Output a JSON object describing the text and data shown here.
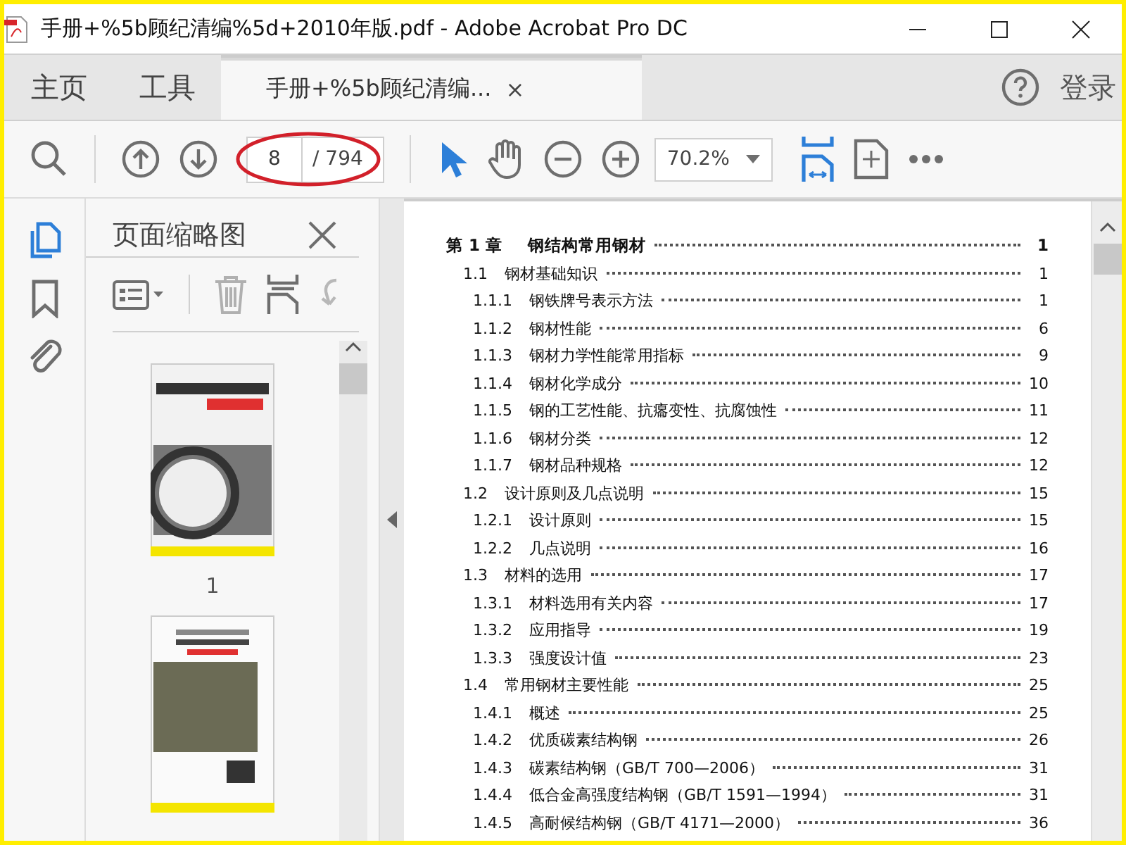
{
  "window": {
    "title": "手册+%5b顾纪清编%5d+2010年版.pdf - Adobe Acrobat Pro DC"
  },
  "tabs": [
    {
      "label": "主页",
      "kind": "home",
      "selected": false
    },
    {
      "label": "工具",
      "kind": "tools",
      "selected": false
    },
    {
      "label": "手册+%5b顾纪清编...",
      "kind": "document",
      "selected": true,
      "close": "×"
    }
  ],
  "account": {
    "label": "登录"
  },
  "toolbar": {
    "page_field": {
      "value": "8"
    },
    "page_total": "/ 794",
    "zoom": {
      "value": "70.2%"
    }
  },
  "side_rail": [
    {
      "kind": "pages",
      "selected": true
    },
    {
      "kind": "bookmarks",
      "selected": false
    },
    {
      "kind": "attachments",
      "selected": false
    }
  ],
  "thumbnail_panel": {
    "title": "页面缩略图",
    "thumbnails": [
      {
        "kind": "front-cover",
        "label": "1"
      },
      {
        "kind": "back-cover"
      }
    ]
  },
  "toc": [
    {
      "number": "第 1 章",
      "title": "钢结构常用钢材",
      "page": "1",
      "children": [
        {
          "number": "1.1",
          "title": "钢材基础知识",
          "page": "1",
          "children": [
            {
              "number": "1.1.1",
              "title": "钢铁牌号表示方法",
              "page": "1"
            },
            {
              "number": "1.1.2",
              "title": "钢材性能",
              "page": "6"
            },
            {
              "number": "1.1.3",
              "title": "钢材力学性能常用指标",
              "page": "9"
            },
            {
              "number": "1.1.4",
              "title": "钢材化学成分",
              "page": "10"
            },
            {
              "number": "1.1.5",
              "title": "钢的工艺性能、抗癟变性、抗腐蚀性",
              "page": "11"
            },
            {
              "number": "1.1.6",
              "title": "钢材分类",
              "page": "12"
            },
            {
              "number": "1.1.7",
              "title": "钢材品种规格",
              "page": "12"
            }
          ]
        },
        {
          "number": "1.2",
          "title": "设计原则及几点说明",
          "page": "15",
          "children": [
            {
              "number": "1.2.1",
              "title": "设计原则",
              "page": "15"
            },
            {
              "number": "1.2.2",
              "title": "几点说明",
              "page": "16"
            }
          ]
        },
        {
          "number": "1.3",
          "title": "材料的选用",
          "page": "17",
          "children": [
            {
              "number": "1.3.1",
              "title": "材料选用有关内容",
              "page": "17"
            },
            {
              "number": "1.3.2",
              "title": "应用指导",
              "page": "19"
            },
            {
              "number": "1.3.3",
              "title": "强度设计值",
              "page": "23"
            }
          ]
        },
        {
          "number": "1.4",
          "title": "常用钢材主要性能",
          "page": "25",
          "children": [
            {
              "number": "1.4.1",
              "title": "概述",
              "page": "25"
            },
            {
              "number": "1.4.2",
              "title": "优质碳素结构钢",
              "page": "26"
            },
            {
              "number": "1.4.3",
              "title": "碳素结构钢（GB/T 700—2006）",
              "page": "31"
            },
            {
              "number": "1.4.4",
              "title": "低合金高强度结构钢（GB/T 1591—1994）",
              "page": "31"
            },
            {
              "number": "1.4.5",
              "title": "高耐候结构钢（GB/T 4171—2000）",
              "page": "36"
            }
          ]
        }
      ]
    }
  ]
}
